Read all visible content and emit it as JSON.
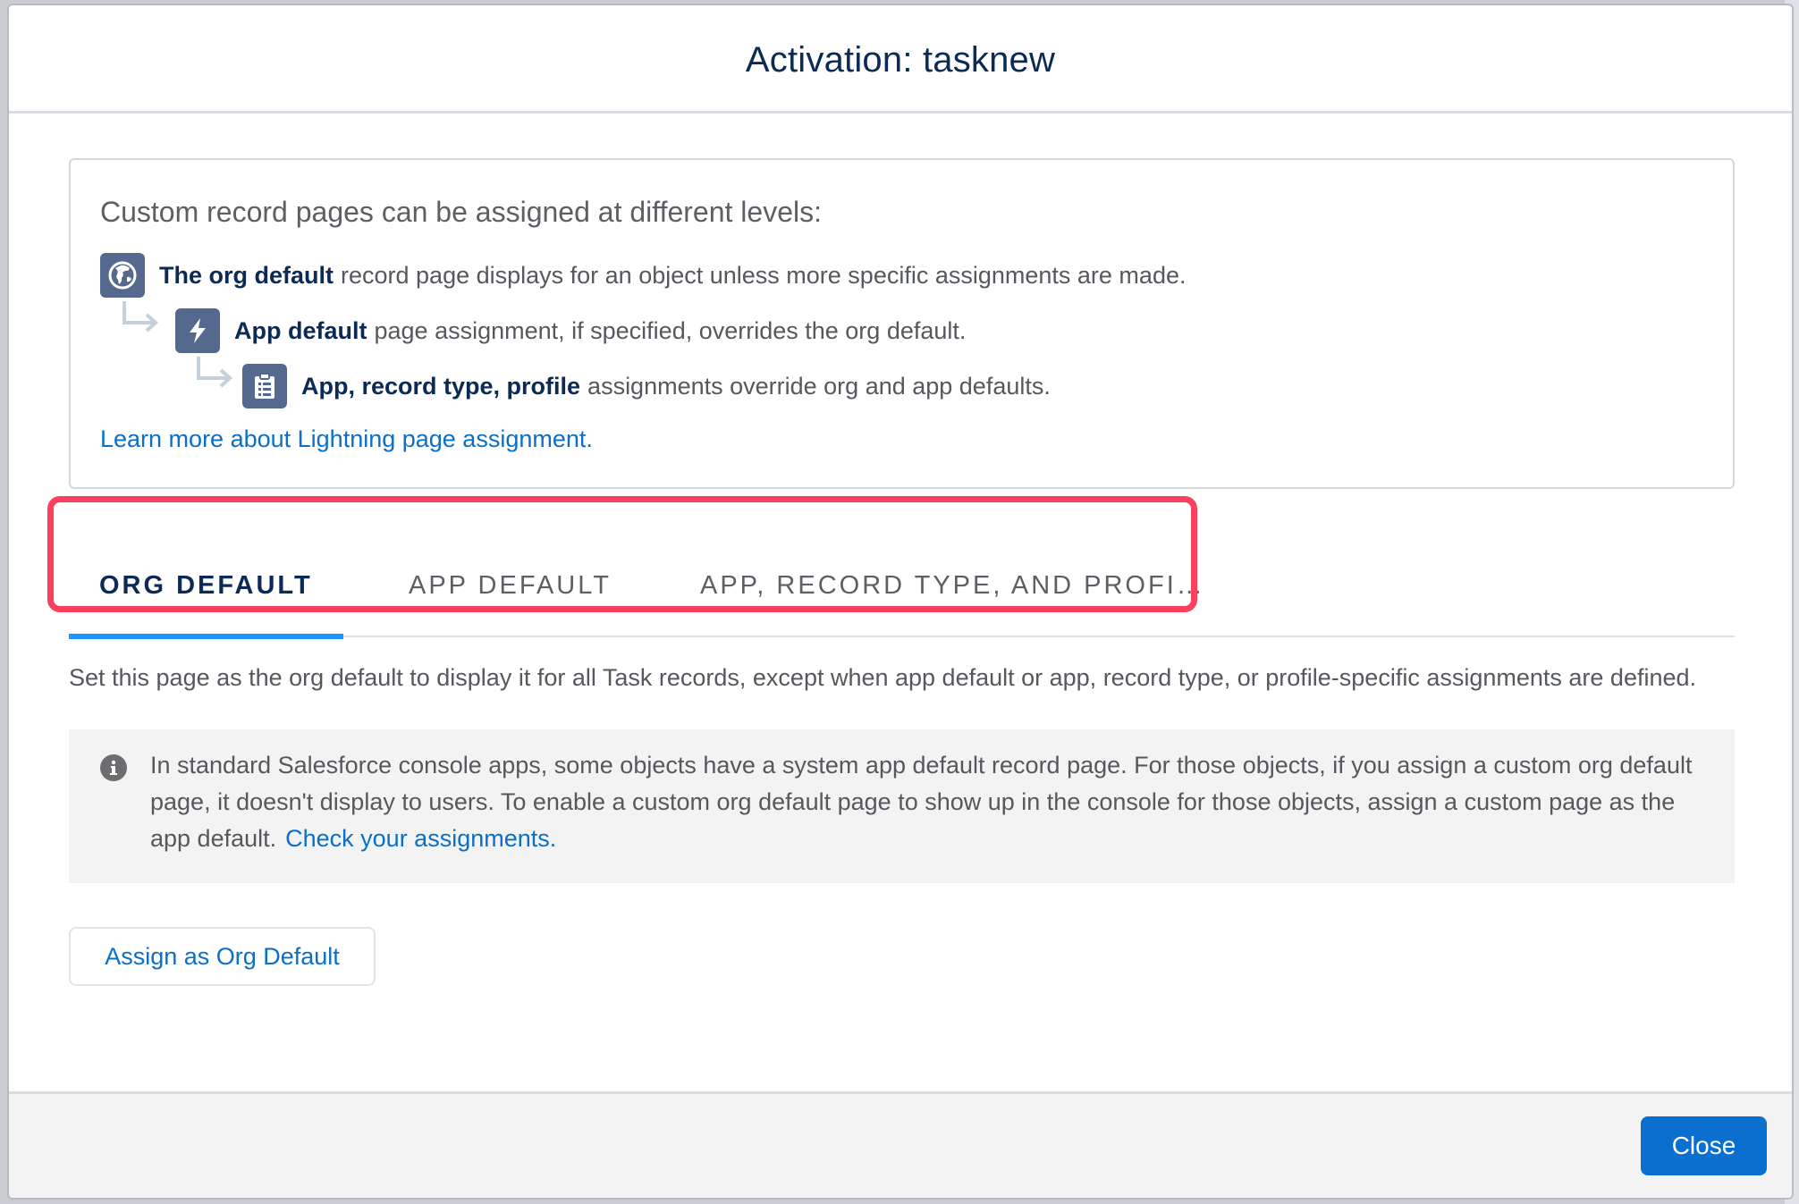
{
  "modal": {
    "title": "Activation: tasknew"
  },
  "levels": {
    "heading": "Custom record pages can be assigned at different levels:",
    "items": [
      {
        "icon": "globe-icon",
        "bold": "The org default",
        "text": "record page displays for an object unless more specific assignments are made."
      },
      {
        "icon": "lightning-bolt-icon",
        "bold": "App default",
        "text": "page assignment, if specified, overrides the org default."
      },
      {
        "icon": "clipboard-list-icon",
        "bold": "App, record type, profile",
        "text": "assignments override org and app defaults."
      }
    ],
    "learn_more_link": "Learn more about Lightning page assignment."
  },
  "tabs": [
    {
      "label": "ORG DEFAULT",
      "active": true
    },
    {
      "label": "APP DEFAULT",
      "active": false
    },
    {
      "label": "APP, RECORD TYPE, AND PROFI…",
      "active": false
    }
  ],
  "description": "Set this page as the org default to display it for all Task records, except when app default or app, record type, or profile-specific assignments are defined.",
  "notice": {
    "icon": "info-icon",
    "text": "In standard Salesforce console apps, some objects have a system app default record page. For those objects, if you assign a custom org default page, it doesn't display to users. To enable a custom org default page to show up in the console for those objects, assign a custom page as the app default.",
    "link": "Check your assignments."
  },
  "actions": {
    "assign_label": "Assign as Org Default"
  },
  "footer": {
    "close_label": "Close"
  },
  "colors": {
    "brand_blue": "#0b6fd0",
    "link_blue": "#0b6fc9",
    "title_navy": "#0b2a55",
    "tab_underline": "#1b96ff",
    "highlight_red": "#fb3f5f",
    "icon_slate": "#54698d"
  }
}
